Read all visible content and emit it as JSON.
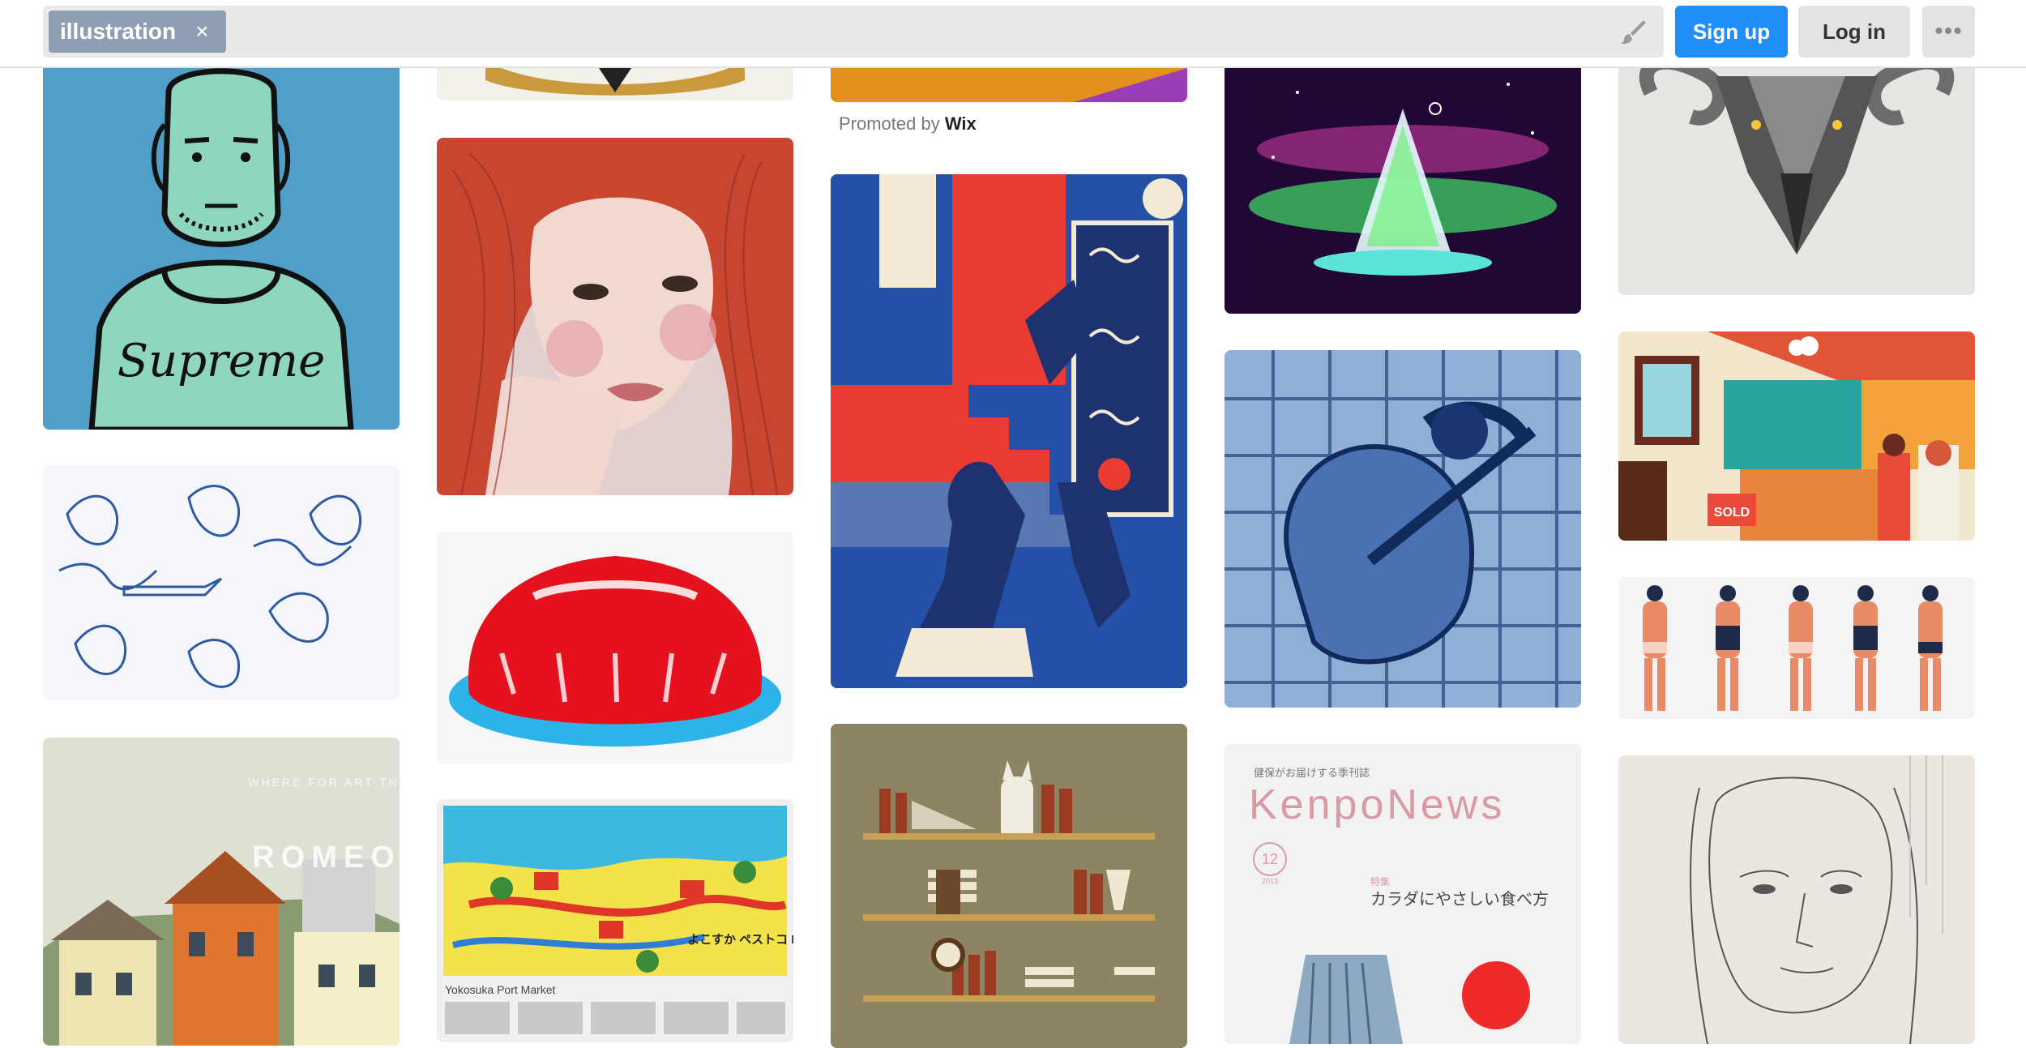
{
  "search": {
    "tag_label": "illustration",
    "remove_glyph": "×"
  },
  "header": {
    "signup_label": "Sign up",
    "login_label": "Log in",
    "more_glyph": "•••"
  },
  "promo": {
    "prefix": "Promoted by",
    "brand": "Wix"
  },
  "pins": {
    "sold_sign": "SOLD",
    "romeo_title": "ROMEO",
    "romeo_subtitle": "WHERE FOR ART THOU",
    "kenpo_top": "健保がお届けする季刊誌",
    "kenpo_title": "KenpoNews",
    "kenpo_issue": "12",
    "kenpo_issue_year": "2013",
    "kenpo_feature_label": "特集",
    "kenpo_feature": "カラダにやさしい食べ方",
    "map_title": "よこすか ペストコ MAP",
    "map_caption": "Yokosuka Port Market"
  },
  "colors": {
    "tag": "#8e9fb3",
    "signup": "#1f8ff7",
    "button_grey": "#e3e3e3",
    "searchbar": "#e9e9e9"
  }
}
